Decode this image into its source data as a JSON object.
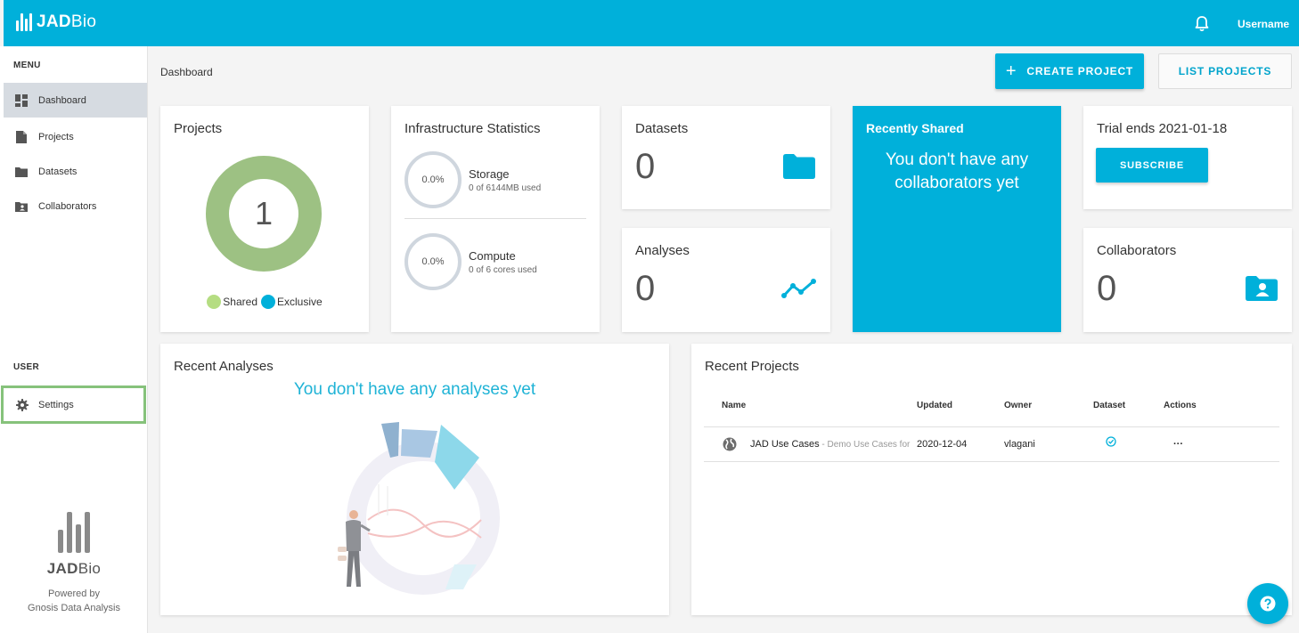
{
  "header": {
    "logo_bold": "JAD",
    "logo_thin": "Bio",
    "username": "Username",
    "icons": {
      "notification": "bell-icon"
    }
  },
  "sidebar": {
    "menu_label": "MENU",
    "items": [
      {
        "label": "Dashboard",
        "icon": "dashboard-icon",
        "active": true
      },
      {
        "label": "Projects",
        "icon": "file-icon"
      },
      {
        "label": "Datasets",
        "icon": "folder-icon"
      },
      {
        "label": "Collaborators",
        "icon": "contact-folder-icon"
      }
    ],
    "user_label": "USER",
    "settings": {
      "label": "Settings",
      "icon": "gear-icon"
    },
    "footer": {
      "logo_bold": "JAD",
      "logo_thin": "Bio",
      "powered_by": "Powered by",
      "company": "Gnosis Data Analysis"
    }
  },
  "breadcrumb": "Dashboard",
  "toolbar": {
    "create_label": "CREATE PROJECT",
    "list_label": "LIST PROJECTS"
  },
  "projects_card": {
    "title": "Projects",
    "count": "1",
    "legend": [
      {
        "label": "Shared",
        "color": "#b5dd82"
      },
      {
        "label": "Exclusive",
        "color": "#00b0da"
      }
    ]
  },
  "infrastructure": {
    "title": "Infrastructure Statistics",
    "storage": {
      "percent": "0.0%",
      "label": "Storage",
      "detail": "0 of 6144MB used"
    },
    "compute": {
      "percent": "0.0%",
      "label": "Compute",
      "detail": "0 of 6 cores used"
    }
  },
  "datasets_card": {
    "title": "Datasets",
    "count": "0",
    "icon": "folder-icon"
  },
  "analyses_card": {
    "title": "Analyses",
    "count": "0",
    "icon": "trend-line-icon"
  },
  "shared_card": {
    "title": "Recently Shared",
    "message_line1": "You don't have any",
    "message_line2": "collaborators yet"
  },
  "trial_card": {
    "title": "Trial ends 2021-01-18",
    "subscribe_label": "SUBSCRIBE"
  },
  "collaborators_card": {
    "title": "Collaborators",
    "count": "0",
    "icon": "contact-folder-icon"
  },
  "recent_analyses": {
    "title": "Recent Analyses",
    "empty_message": "You don't have any analyses yet"
  },
  "recent_projects": {
    "title": "Recent Projects",
    "columns": [
      "Name",
      "Updated",
      "Owner",
      "Dataset",
      "Actions"
    ],
    "rows": [
      {
        "name": "JAD Use Cases",
        "description": " - Demo Use Cases for",
        "updated": "2020-12-04",
        "owner": "vlagani",
        "actions": "···"
      }
    ]
  },
  "colors": {
    "brand": "#00b0da",
    "donut": "#9dc183",
    "settings_highlight": "#86c27b"
  }
}
